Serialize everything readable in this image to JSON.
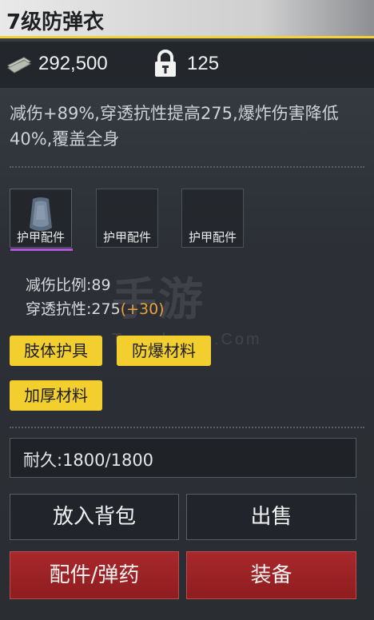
{
  "header": {
    "title": "7级防弹衣"
  },
  "currency": {
    "cash": "292,500",
    "locked": "125"
  },
  "description": "减伤+89%,穿透抗性提高275,爆炸伤害降低40%,覆盖全身",
  "slots": [
    {
      "label": "护甲配件",
      "filled": true
    },
    {
      "label": "护甲配件",
      "filled": false
    },
    {
      "label": "护甲配件",
      "filled": false
    }
  ],
  "stats": {
    "damage_reduction_label": "减伤比例:",
    "damage_reduction_value": "89",
    "penetration_label": "穿透抗性:",
    "penetration_value": "275",
    "penetration_bonus": "(+30)"
  },
  "tags": [
    "肢体护具",
    "防爆材料",
    "加厚材料"
  ],
  "durability": "耐久:1800/1800",
  "buttons": {
    "put_in_backpack": "放入背包",
    "sell": "出售",
    "attachments_ammo": "配件/弹药",
    "equip": "装备"
  },
  "watermark": {
    "main": "手游",
    "sub": "Tao shou u.Com"
  },
  "colors": {
    "accent_yellow": "#f2cf2e",
    "button_red": "#a8282b",
    "bonus_orange": "#e9a23b",
    "slot_highlight": "#b056d8"
  }
}
